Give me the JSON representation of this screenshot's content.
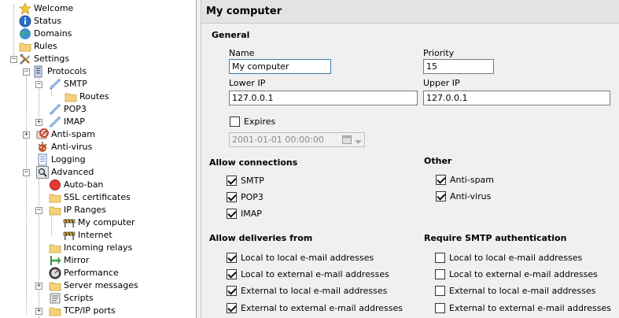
{
  "tree": {
    "items": [
      {
        "label": "Welcome",
        "icon": "star-icon"
      },
      {
        "label": "Status",
        "icon": "info-icon"
      },
      {
        "label": "Domains",
        "icon": "globe-icon"
      },
      {
        "label": "Rules",
        "icon": "folder-icon"
      },
      {
        "label": "Settings",
        "icon": "tools-icon"
      },
      {
        "label": "Protocols",
        "icon": "server-icon"
      },
      {
        "label": "SMTP",
        "icon": "protocol-icon"
      },
      {
        "label": "Routes",
        "icon": "folder-icon"
      },
      {
        "label": "POP3",
        "icon": "protocol-icon"
      },
      {
        "label": "IMAP",
        "icon": "protocol-icon"
      },
      {
        "label": "Anti-spam",
        "icon": "antispam-icon"
      },
      {
        "label": "Anti-virus",
        "icon": "antivirus-icon"
      },
      {
        "label": "Logging",
        "icon": "log-icon"
      },
      {
        "label": "Advanced",
        "icon": "magnifier-icon"
      },
      {
        "label": "Auto-ban",
        "icon": "red-circle-icon"
      },
      {
        "label": "SSL certificates",
        "icon": "folder-icon"
      },
      {
        "label": "IP Ranges",
        "icon": "folder-icon"
      },
      {
        "label": "My computer",
        "icon": "barrier-icon"
      },
      {
        "label": "Internet",
        "icon": "barrier-icon"
      },
      {
        "label": "Incoming relays",
        "icon": "folder-icon"
      },
      {
        "label": "Mirror",
        "icon": "mirror-icon"
      },
      {
        "label": "Performance",
        "icon": "gauge-icon"
      },
      {
        "label": "Server messages",
        "icon": "folder-icon"
      },
      {
        "label": "Scripts",
        "icon": "script-icon"
      },
      {
        "label": "TCP/IP ports",
        "icon": "folder-icon"
      }
    ]
  },
  "panel": {
    "title": "My computer",
    "general_heading": "General",
    "name_label": "Name",
    "name_value": "My computer",
    "priority_label": "Priority",
    "priority_value": "15",
    "lower_ip_label": "Lower IP",
    "lower_ip_value": "127.0.0.1",
    "upper_ip_label": "Upper IP",
    "upper_ip_value": "127.0.0.1",
    "expires_label": "Expires",
    "expires_checked": false,
    "expires_value": "2001-01-01 00:00:00",
    "allow_connections_heading": "Allow connections",
    "allow_connections": [
      {
        "label": "SMTP",
        "checked": true
      },
      {
        "label": "POP3",
        "checked": true
      },
      {
        "label": "IMAP",
        "checked": true
      }
    ],
    "other_heading": "Other",
    "other": [
      {
        "label": "Anti-spam",
        "checked": true
      },
      {
        "label": "Anti-virus",
        "checked": true
      }
    ],
    "allow_deliveries_heading": "Allow deliveries from",
    "allow_deliveries": [
      {
        "label": "Local to local e-mail addresses",
        "checked": true
      },
      {
        "label": "Local to external e-mail addresses",
        "checked": true
      },
      {
        "label": "External to local e-mail addresses",
        "checked": true
      },
      {
        "label": "External to external e-mail addresses",
        "checked": true
      }
    ],
    "require_auth_heading": "Require SMTP authentication",
    "require_auth": [
      {
        "label": "Local to local e-mail addresses",
        "checked": false
      },
      {
        "label": "Local to external e-mail addresses",
        "checked": false
      },
      {
        "label": "External to local e-mail addresses",
        "checked": false
      },
      {
        "label": "External to external e-mail addresses",
        "checked": false
      }
    ]
  }
}
